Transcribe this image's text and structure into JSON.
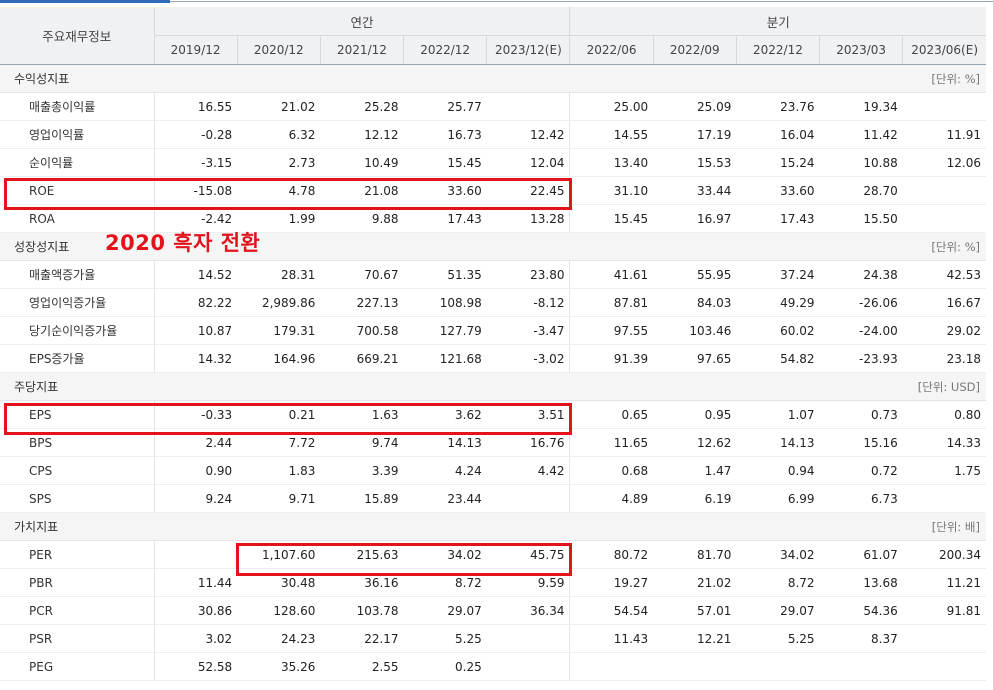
{
  "header": {
    "corner": "주요재무정보",
    "annual_label": "연간",
    "quarter_label": "분기",
    "periods": [
      "2019/12",
      "2020/12",
      "2021/12",
      "2022/12",
      "2023/12(E)",
      "2022/06",
      "2022/09",
      "2022/12",
      "2023/03",
      "2023/06(E)"
    ]
  },
  "sections": [
    {
      "name": "수익성지표",
      "unit": "[단위: %]",
      "rows": [
        {
          "label": "매출총이익률",
          "values": [
            "16.55",
            "21.02",
            "25.28",
            "25.77",
            "",
            "25.00",
            "25.09",
            "23.76",
            "19.34",
            ""
          ]
        },
        {
          "label": "영업이익률",
          "values": [
            "-0.28",
            "6.32",
            "12.12",
            "16.73",
            "12.42",
            "14.55",
            "17.19",
            "16.04",
            "11.42",
            "11.91"
          ]
        },
        {
          "label": "순이익률",
          "values": [
            "-3.15",
            "2.73",
            "10.49",
            "15.45",
            "12.04",
            "13.40",
            "15.53",
            "15.24",
            "10.88",
            "12.06"
          ]
        },
        {
          "label": "ROE",
          "values": [
            "-15.08",
            "4.78",
            "21.08",
            "33.60",
            "22.45",
            "31.10",
            "33.44",
            "33.60",
            "28.70",
            ""
          ]
        },
        {
          "label": "ROA",
          "values": [
            "-2.42",
            "1.99",
            "9.88",
            "17.43",
            "13.28",
            "15.45",
            "16.97",
            "17.43",
            "15.50",
            ""
          ]
        }
      ]
    },
    {
      "name": "성장성지표",
      "unit": "[단위: %]",
      "rows": [
        {
          "label": "매출액증가율",
          "values": [
            "14.52",
            "28.31",
            "70.67",
            "51.35",
            "23.80",
            "41.61",
            "55.95",
            "37.24",
            "24.38",
            "42.53"
          ]
        },
        {
          "label": "영업이익증가율",
          "values": [
            "82.22",
            "2,989.86",
            "227.13",
            "108.98",
            "-8.12",
            "87.81",
            "84.03",
            "49.29",
            "-26.06",
            "16.67"
          ]
        },
        {
          "label": "당기순이익증가율",
          "values": [
            "10.87",
            "179.31",
            "700.58",
            "127.79",
            "-3.47",
            "97.55",
            "103.46",
            "60.02",
            "-24.00",
            "29.02"
          ]
        },
        {
          "label": "EPS증가율",
          "values": [
            "14.32",
            "164.96",
            "669.21",
            "121.68",
            "-3.02",
            "91.39",
            "97.65",
            "54.82",
            "-23.93",
            "23.18"
          ]
        }
      ]
    },
    {
      "name": "주당지표",
      "unit": "[단위: USD]",
      "rows": [
        {
          "label": "EPS",
          "values": [
            "-0.33",
            "0.21",
            "1.63",
            "3.62",
            "3.51",
            "0.65",
            "0.95",
            "1.07",
            "0.73",
            "0.80"
          ]
        },
        {
          "label": "BPS",
          "values": [
            "2.44",
            "7.72",
            "9.74",
            "14.13",
            "16.76",
            "11.65",
            "12.62",
            "14.13",
            "15.16",
            "14.33"
          ]
        },
        {
          "label": "CPS",
          "values": [
            "0.90",
            "1.83",
            "3.39",
            "4.24",
            "4.42",
            "0.68",
            "1.47",
            "0.94",
            "0.72",
            "1.75"
          ]
        },
        {
          "label": "SPS",
          "values": [
            "9.24",
            "9.71",
            "15.89",
            "23.44",
            "",
            "4.89",
            "6.19",
            "6.99",
            "6.73",
            ""
          ]
        }
      ]
    },
    {
      "name": "가치지표",
      "unit": "[단위: 배]",
      "rows": [
        {
          "label": "PER",
          "values": [
            "",
            "1,107.60",
            "215.63",
            "34.02",
            "45.75",
            "80.72",
            "81.70",
            "34.02",
            "61.07",
            "200.34"
          ]
        },
        {
          "label": "PBR",
          "values": [
            "11.44",
            "30.48",
            "36.16",
            "8.72",
            "9.59",
            "19.27",
            "21.02",
            "8.72",
            "13.68",
            "11.21"
          ]
        },
        {
          "label": "PCR",
          "values": [
            "30.86",
            "128.60",
            "103.78",
            "29.07",
            "36.34",
            "54.54",
            "57.01",
            "29.07",
            "54.36",
            "91.81"
          ]
        },
        {
          "label": "PSR",
          "values": [
            "3.02",
            "24.23",
            "22.17",
            "5.25",
            "",
            "11.43",
            "12.21",
            "5.25",
            "8.37",
            ""
          ]
        },
        {
          "label": "PEG",
          "values": [
            "52.58",
            "35.26",
            "2.55",
            "0.25",
            "",
            "",
            "",
            "",
            "",
            ""
          ]
        }
      ]
    }
  ],
  "annotation": {
    "text": "2020 흑자 전환",
    "color": "#e3131c"
  }
}
